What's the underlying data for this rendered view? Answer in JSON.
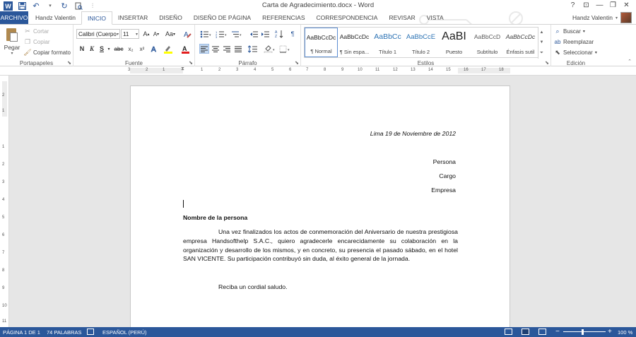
{
  "window": {
    "title": "Carta de Agradecimiento.docx - Word",
    "help": "?",
    "ribbon_display": "⊡",
    "minimize": "—",
    "restore": "❐",
    "close": "✕"
  },
  "quick_access": {
    "save_icon": "save-icon",
    "undo_icon": "undo-icon",
    "redo_icon": "redo-icon",
    "print_preview_icon": "print-preview-icon",
    "customize_icon": "customize-icon"
  },
  "tabs": {
    "file": "ARCHIVO",
    "user_tab": "Handz Valentin",
    "items": [
      "INICIO",
      "INSERTAR",
      "DISEÑO",
      "DISEÑO DE PÁGINA",
      "REFERENCIAS",
      "CORRESPONDENCIA",
      "REVISAR",
      "VISTA"
    ],
    "active": "INICIO"
  },
  "user": {
    "name": "Handz Valentin"
  },
  "ribbon": {
    "clipboard": {
      "label": "Portapapeles",
      "paste": "Pegar",
      "cut": "Cortar",
      "copy": "Copiar",
      "format_painter": "Copiar formato"
    },
    "font": {
      "label": "Fuente",
      "font_name": "Calibri (Cuerpo",
      "font_size": "11",
      "grow": "A",
      "shrink": "A",
      "case": "Aa",
      "bold": "N",
      "italic": "K",
      "underline": "S",
      "strike": "abc",
      "subscript": "x₂",
      "superscript": "x²"
    },
    "paragraph": {
      "label": "Párrafo",
      "pilcrow": "¶"
    },
    "styles": {
      "label": "Estilos",
      "items": [
        {
          "preview": "AaBbCcDc",
          "name": "¶ Normal"
        },
        {
          "preview": "AaBbCcDc",
          "name": "¶ Sin espa..."
        },
        {
          "preview": "AaBbCc",
          "name": "Título 1"
        },
        {
          "preview": "AaBbCcE",
          "name": "Título 2"
        },
        {
          "preview": "AaBI",
          "name": "Puesto"
        },
        {
          "preview": "AaBbCcD",
          "name": "Subtítulo"
        },
        {
          "preview": "AaBbCcDc",
          "name": "Énfasis sutil"
        }
      ]
    },
    "editing": {
      "label": "Edición",
      "find": "Buscar",
      "replace": "Reemplazar",
      "select": "Seleccionar"
    }
  },
  "ruler": {
    "numbers": [
      "3",
      "2",
      "1",
      "1",
      "2",
      "3",
      "4",
      "5",
      "6",
      "7",
      "8",
      "9",
      "10",
      "11",
      "12",
      "13",
      "14",
      "15",
      "16",
      "17",
      "18"
    ],
    "vnumbers": [
      "2",
      "1",
      "1",
      "2",
      "3",
      "4",
      "5",
      "6",
      "7",
      "8",
      "9",
      "10",
      "11"
    ]
  },
  "document": {
    "date": "Lima 19 de Noviembre de 2012",
    "persona": "Persona",
    "cargo": "Cargo",
    "empresa": "Empresa",
    "name_heading": "Nombre de la persona",
    "body": "Una vez finalizados los actos de conmemoración del Aniversario de nuestra prestigiosa empresa Handsofthelp S.A.C., quiero agradecerle encarecidamente su colaboración en la organización y desarrollo de los mismos, y en concreto, su presencia el pasado sábado, en el hotel SAN VICENTE. Su participación contribuyó sin duda, al éxito general de la jornada.",
    "closing": "Reciba un cordial saludo."
  },
  "status": {
    "page": "PÁGINA 1 DE 1",
    "words": "74 PALABRAS",
    "language": "ESPAÑOL (PERÚ)",
    "zoom": "100 %",
    "zoom_minus": "−",
    "zoom_plus": "+"
  },
  "colors": {
    "accent": "#2b579a",
    "status_bar": "#2b579a",
    "highlight": "#ffff00",
    "font_color": "#e21d1d"
  }
}
